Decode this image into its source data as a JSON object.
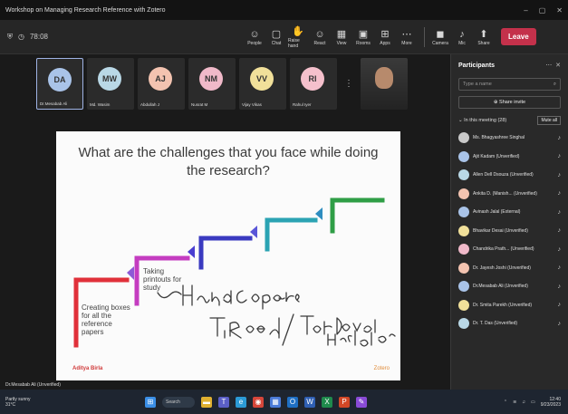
{
  "window": {
    "title": "Workshop on Managing Research Reference with Zotero"
  },
  "toolbar": {
    "timer": "78:08",
    "buttons": [
      {
        "label": "People",
        "icon": "people-icon",
        "glyph": "☺"
      },
      {
        "label": "Chat",
        "icon": "chat-icon",
        "glyph": "▢"
      },
      {
        "label": "Raise hand",
        "icon": "raise-hand-icon",
        "glyph": "✋"
      },
      {
        "label": "React",
        "icon": "react-icon",
        "glyph": "☺"
      },
      {
        "label": "View",
        "icon": "view-icon",
        "glyph": "▦"
      },
      {
        "label": "Rooms",
        "icon": "rooms-icon",
        "glyph": "▣"
      },
      {
        "label": "Apps",
        "icon": "apps-icon",
        "glyph": "⊞"
      },
      {
        "label": "More",
        "icon": "more-icon",
        "glyph": "⋯"
      },
      {
        "label": "Camera",
        "icon": "camera-icon",
        "glyph": "◼"
      },
      {
        "label": "Mic",
        "icon": "mic-icon",
        "glyph": "♪"
      },
      {
        "label": "Share",
        "icon": "share-icon",
        "glyph": "⬆"
      }
    ],
    "leave_label": "Leave"
  },
  "tiles": [
    {
      "initials": "DA",
      "name": "Dr.Mesabab Ali",
      "color": "#a9c3e8"
    },
    {
      "initials": "MW",
      "name": "Md. Wasim",
      "color": "#b9d8e6"
    },
    {
      "initials": "AJ",
      "name": "Abdullah J",
      "color": "#f3c3b0"
    },
    {
      "initials": "NM",
      "name": "Nusrat M",
      "color": "#f0b9c9"
    },
    {
      "initials": "VV",
      "name": "Vijay Vikas",
      "color": "#f1e09a"
    },
    {
      "initials": "RI",
      "name": "Rahul Iyer",
      "color": "#f5c0cc"
    }
  ],
  "slide": {
    "title": "What are the challenges that you face while doing the research?",
    "steps": [
      {
        "text": "Creating boxes for all the reference papers"
      },
      {
        "text": "Taking printouts for study"
      }
    ],
    "brand": "Aditya Birla",
    "page": "Zotero"
  },
  "speaker_label": "Dr.Mesabab Ali (Unverified)",
  "participants_panel": {
    "title": "Participants",
    "search_placeholder": "Type a name",
    "share_invite": "Share invite",
    "section_label": "In this meeting (28)",
    "mute_all": "Mute all",
    "people": [
      {
        "name": "Ms. Bhagyashree Singhal",
        "color": "#c9c9c9"
      },
      {
        "name": "Ajit Kadam (Unverified)",
        "color": "#a9c3e8"
      },
      {
        "name": "Allen Dell Dsouza (Unverified)",
        "color": "#b9d8e6"
      },
      {
        "name": "Ankita D. (Manish... (Unverified)",
        "color": "#f3c3b0"
      },
      {
        "name": "Avinash Jalal (External)",
        "color": "#a9c3e8"
      },
      {
        "name": "Bhavikar Desai (Unverified)",
        "color": "#f1e09a"
      },
      {
        "name": "Chandrika Prath... (Unverified)",
        "color": "#f0b9c9"
      },
      {
        "name": "Dr. Jayesh Joshi (Unverified)",
        "color": "#f3c3b0"
      },
      {
        "name": "Dr.Mesabab Ali (Unverified)",
        "color": "#a9c3e8"
      },
      {
        "name": "Dr. Smita Parekh (Unverified)",
        "color": "#f1e09a"
      },
      {
        "name": "Dr. T. Das (Unverified)",
        "color": "#b9d8e6"
      }
    ]
  },
  "taskbar": {
    "weather_line1": "Partly sunny",
    "weather_line2": "31°C",
    "search_label": "Search",
    "time": "12:40",
    "date": "9/23/2023"
  }
}
